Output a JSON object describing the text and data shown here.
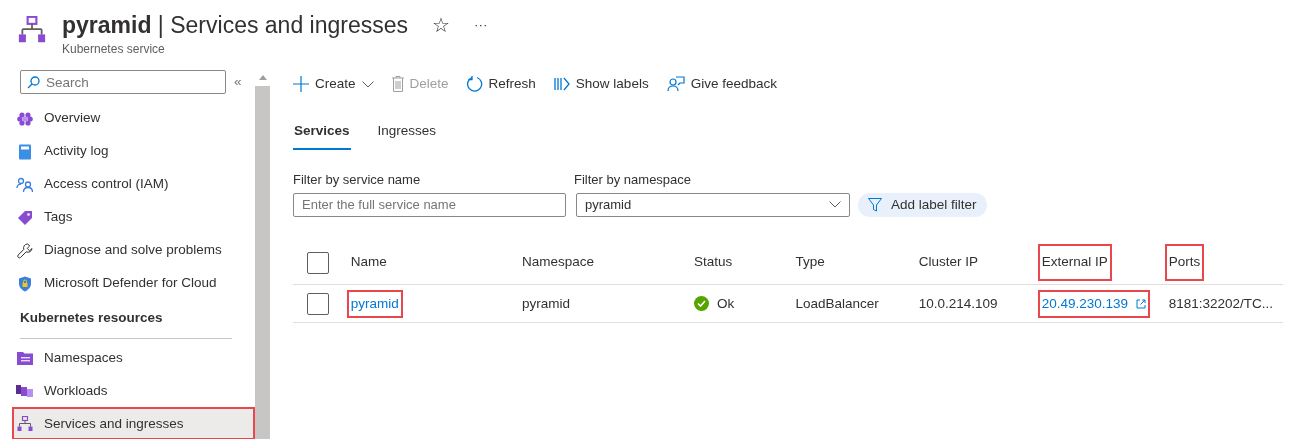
{
  "header": {
    "title": "**pyramid** | Services and ingresses",
    "subtitle": "Kubernetes service",
    "favorite": "☆",
    "more": "···"
  },
  "sidebar": {
    "search": {
      "placeholder": "Search"
    },
    "collapse": "«",
    "items": [
      {
        "label": "Overview",
        "selected": false,
        "highlighted": false
      },
      {
        "label": "Activity log",
        "selected": false,
        "highlighted": false
      },
      {
        "label": "Access control (IAM)",
        "selected": false,
        "highlighted": false
      },
      {
        "label": "Tags",
        "selected": false,
        "highlighted": false
      },
      {
        "label": "Diagnose and solve problems",
        "selected": false,
        "highlighted": false
      },
      {
        "label": "Microsoft Defender for Cloud",
        "selected": false,
        "highlighted": false
      }
    ],
    "section": "Kubernetes resources",
    "resource_items": [
      {
        "label": "Namespaces",
        "selected": false,
        "highlighted": false
      },
      {
        "label": "Workloads",
        "selected": false,
        "highlighted": false
      },
      {
        "label": "Services and ingresses",
        "selected": true,
        "highlighted": true
      }
    ]
  },
  "toolbar": [
    {
      "label": "Create",
      "disabled": false,
      "dropdown": true
    },
    {
      "label": "Delete",
      "disabled": true,
      "dropdown": false
    },
    {
      "label": "Refresh",
      "disabled": false,
      "dropdown": false
    },
    {
      "label": "Show labels",
      "disabled": false,
      "dropdown": false
    },
    {
      "label": "Give feedback",
      "disabled": false,
      "dropdown": false
    }
  ],
  "tabs": [
    {
      "label": "Services",
      "selected": true
    },
    {
      "label": "Ingresses",
      "selected": false
    }
  ],
  "filters": [
    {
      "kind": "text",
      "label": "Filter by service name",
      "placeholder": "Enter the full service name"
    },
    {
      "kind": "select",
      "label": "Filter by namespace",
      "value": "pyramid"
    }
  ],
  "add_label_filter": "Add label filter",
  "table": {
    "select_all": {
      "checked": false
    },
    "columns": [
      {
        "label": "Name",
        "highlighted": false
      },
      {
        "label": "Namespace",
        "highlighted": false
      },
      {
        "label": "Status",
        "highlighted": false
      },
      {
        "label": "Type",
        "highlighted": false
      },
      {
        "label": "Cluster IP",
        "highlighted": false
      },
      {
        "label": "External IP",
        "highlighted": true
      },
      {
        "label": "Ports",
        "highlighted": true
      }
    ],
    "rows": [
      {
        "checked": false,
        "cells": [
          {
            "kind": "link",
            "text": "pyramid",
            "highlighted": true
          },
          {
            "kind": "text",
            "text": "pyramid",
            "highlighted": false
          },
          {
            "kind": "status",
            "text": "Ok",
            "highlighted": false
          },
          {
            "kind": "text",
            "text": "LoadBalancer",
            "highlighted": false
          },
          {
            "kind": "text",
            "text": "10.0.214.109",
            "highlighted": false
          },
          {
            "kind": "external-link",
            "text": "20.49.230.139",
            "highlighted": true
          },
          {
            "kind": "text",
            "text": "8181:32202/TC...",
            "highlighted": false
          }
        ]
      }
    ]
  }
}
